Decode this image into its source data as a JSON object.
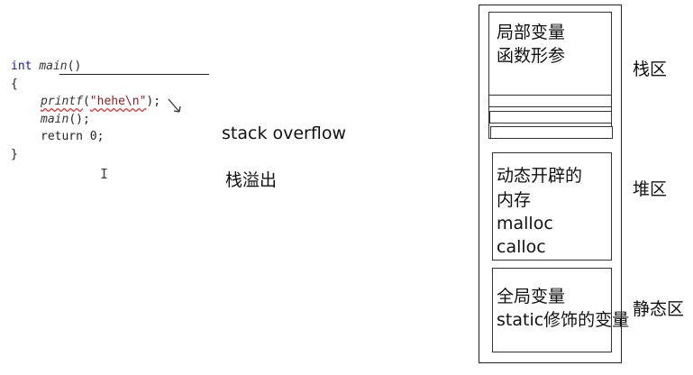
{
  "code": {
    "line1_kw": "int",
    "line1_fn": "main",
    "line1_rest": "()",
    "line2": "{",
    "line3_fn": "printf",
    "line3_open": "(",
    "line3_str": "\"hehe\\n\"",
    "line3_close": ");",
    "line4_fn": "main",
    "line4_rest": "();",
    "line5_kw": "return",
    "line5_rest": " 0;",
    "line6": "}"
  },
  "annotations": {
    "stack_overflow": "stack overflow",
    "stack_overflow_cn": "栈溢出"
  },
  "memory": {
    "stack_box_text": [
      "局部变量",
      "函数形参"
    ],
    "stack_label": "栈区",
    "heap_box_text": [
      "动态开辟的",
      "内存",
      "malloc",
      "calloc"
    ],
    "heap_label": "堆区",
    "static_box_text": [
      "全局变量",
      "static修饰的变量"
    ],
    "static_label": "静态区"
  }
}
